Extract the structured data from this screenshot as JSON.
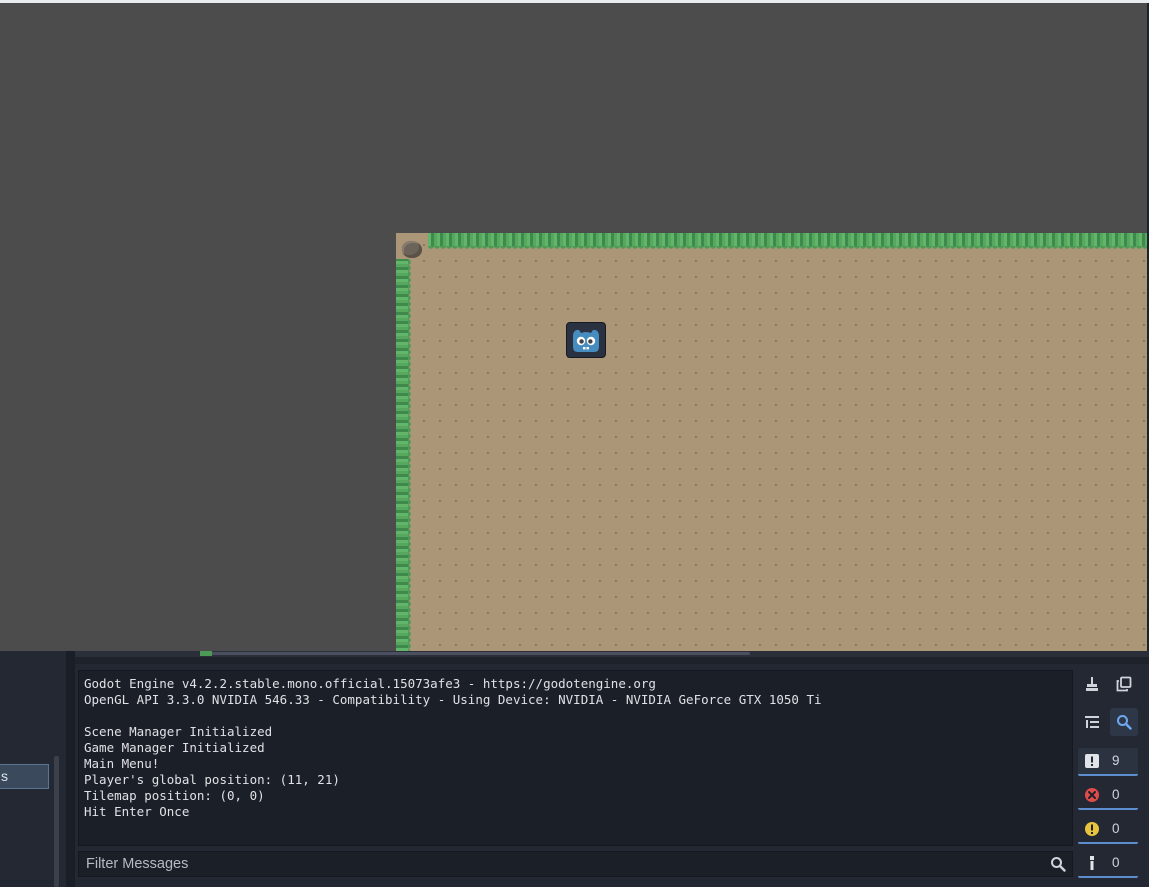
{
  "output": {
    "lines": [
      "Godot Engine v4.2.2.stable.mono.official.15073afe3 - https://godotengine.org",
      "OpenGL API 3.3.0 NVIDIA 546.33 - Compatibility - Using Device: NVIDIA - NVIDIA GeForce GTX 1050 Ti",
      "",
      "Scene Manager Initialized",
      "Game Manager Initialized",
      "Main Menu!",
      "Player's global position: (11, 21)",
      "Tilemap position: (0, 0)",
      "Hit Enter Once"
    ],
    "filter_placeholder": "Filter Messages"
  },
  "counters": {
    "messages": "9",
    "errors": "0",
    "warnings": "0",
    "editor": "0"
  },
  "left_panel": {
    "tab_label": "s"
  },
  "icons": {
    "clear": "broom-icon",
    "copy": "copy-icon",
    "collapse": "collapse-icon",
    "search": "search-icon",
    "player": "godot-robot-icon"
  },
  "colors": {
    "accent": "#5d8fd0",
    "error": "#e14b4b",
    "warning": "#e8c43c",
    "dirt": "#ab9777",
    "grass": "#4b9a55"
  }
}
